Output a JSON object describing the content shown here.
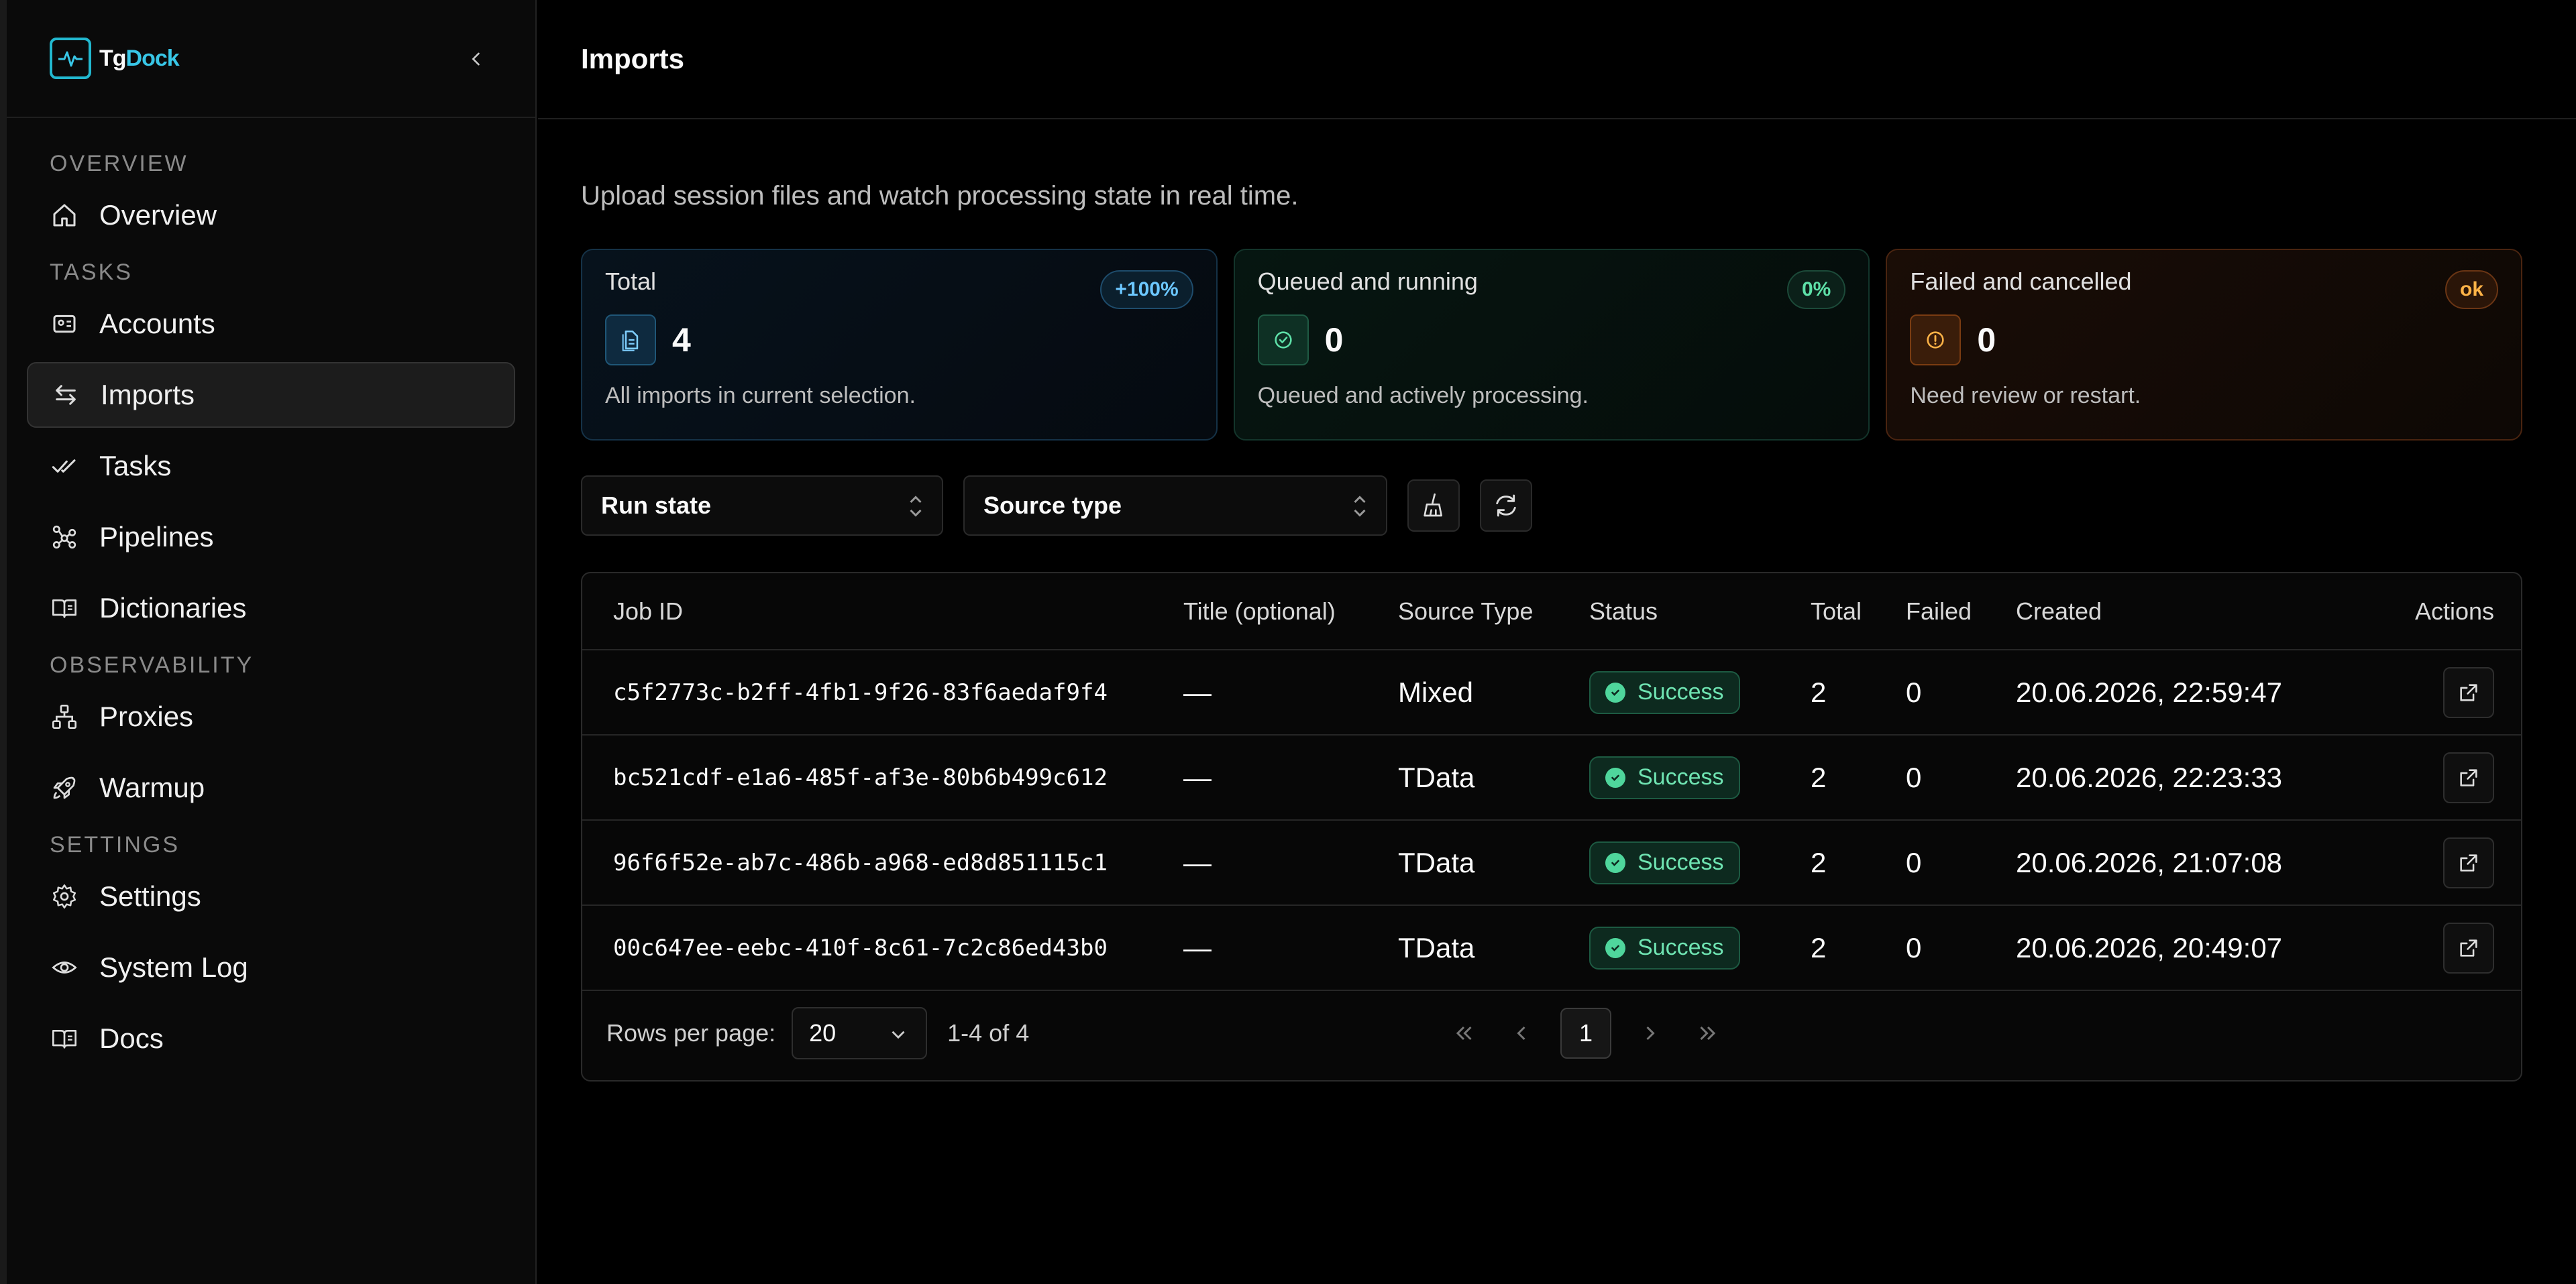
{
  "brand": {
    "name_part1": "Tg",
    "name_part2": "Dock"
  },
  "sidebar": {
    "sections": [
      {
        "label": "OVERVIEW",
        "items": [
          {
            "label": "Overview",
            "icon": "home-icon"
          }
        ]
      },
      {
        "label": "TASKS",
        "items": [
          {
            "label": "Accounts",
            "icon": "id-card-icon"
          },
          {
            "label": "Imports",
            "icon": "arrows-left-right-icon",
            "active": true
          },
          {
            "label": "Tasks",
            "icon": "check-check-icon"
          },
          {
            "label": "Pipelines",
            "icon": "workflow-icon"
          },
          {
            "label": "Dictionaries",
            "icon": "book-icon"
          }
        ]
      },
      {
        "label": "OBSERVABILITY",
        "items": [
          {
            "label": "Proxies",
            "icon": "network-icon"
          },
          {
            "label": "Warmup",
            "icon": "rocket-icon"
          }
        ]
      },
      {
        "label": "SETTINGS",
        "items": [
          {
            "label": "Settings",
            "icon": "gear-icon"
          },
          {
            "label": "System Log",
            "icon": "eye-icon"
          },
          {
            "label": "Docs",
            "icon": "book-icon"
          }
        ]
      }
    ]
  },
  "header": {
    "title": "Imports"
  },
  "main": {
    "subtitle": "Upload session files and watch processing state in real time.",
    "cards": [
      {
        "label": "Total",
        "badge": "+100%",
        "value": "4",
        "desc": "All imports in current selection.",
        "icon": "file-icon"
      },
      {
        "label": "Queued and running",
        "badge": "0%",
        "value": "0",
        "desc": "Queued and actively processing.",
        "icon": "check-circle-icon"
      },
      {
        "label": "Failed and cancelled",
        "badge": "ok",
        "value": "0",
        "desc": "Need review or restart.",
        "icon": "alert-circle-icon"
      }
    ],
    "filters": {
      "run_state": "Run state",
      "source_type": "Source type"
    },
    "table": {
      "columns": [
        "Job ID",
        "Title (optional)",
        "Source Type",
        "Status",
        "Total",
        "Failed",
        "Created",
        "Actions"
      ],
      "rows": [
        {
          "id": "c5f2773c-b2ff-4fb1-9f26-83f6aedaf9f4",
          "title": "—",
          "source": "Mixed",
          "status": "Success",
          "total": "2",
          "failed": "0",
          "created": "20.06.2026, 22:59:47"
        },
        {
          "id": "bc521cdf-e1a6-485f-af3e-80b6b499c612",
          "title": "—",
          "source": "TData",
          "status": "Success",
          "total": "2",
          "failed": "0",
          "created": "20.06.2026, 22:23:33"
        },
        {
          "id": "96f6f52e-ab7c-486b-a968-ed8d851115c1",
          "title": "—",
          "source": "TData",
          "status": "Success",
          "total": "2",
          "failed": "0",
          "created": "20.06.2026, 21:07:08"
        },
        {
          "id": "00c647ee-eebc-410f-8c61-7c2c86ed43b0",
          "title": "—",
          "source": "TData",
          "status": "Success",
          "total": "2",
          "failed": "0",
          "created": "20.06.2026, 20:49:07"
        }
      ]
    },
    "pagination": {
      "rows_label": "Rows per page:",
      "rows_value": "20",
      "range": "1-4 of 4",
      "current_page": "1"
    }
  }
}
